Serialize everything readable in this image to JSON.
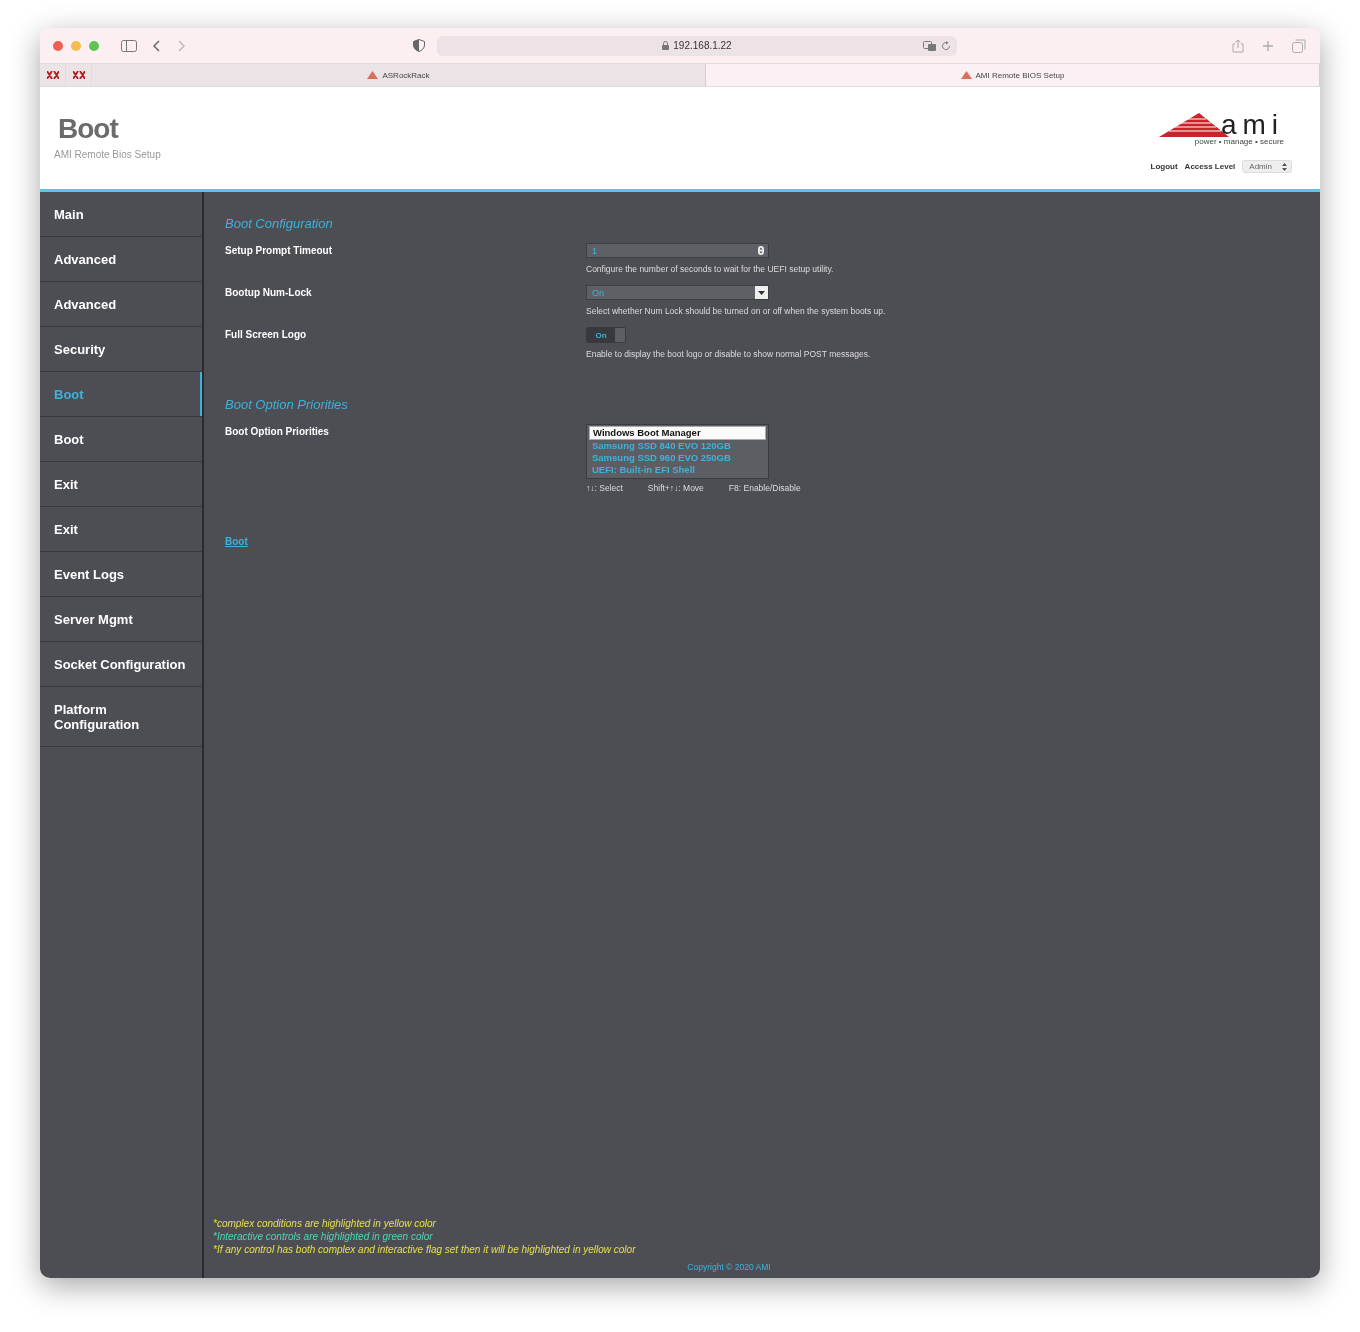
{
  "browser": {
    "url": "192.168.1.22",
    "tabs": [
      {
        "title": "ASRockRack",
        "selected": false
      },
      {
        "title": "AMI Remote BIOS Setup",
        "selected": true
      }
    ]
  },
  "header": {
    "title": "Boot",
    "subtitle": "AMI Remote Bios Setup",
    "logo": {
      "wordmark": "ami",
      "tagline": "power • manage • secure"
    },
    "logout": "Logout",
    "access_level_label": "Access Level",
    "access_level_value": "Admin"
  },
  "sidebar": {
    "items": [
      {
        "label": "Main",
        "selected": false
      },
      {
        "label": "Advanced",
        "selected": false
      },
      {
        "label": "Advanced",
        "selected": false
      },
      {
        "label": "Security",
        "selected": false
      },
      {
        "label": "Boot",
        "selected": true
      },
      {
        "label": "Boot",
        "selected": false
      },
      {
        "label": "Exit",
        "selected": false
      },
      {
        "label": "Exit",
        "selected": false
      },
      {
        "label": "Event Logs",
        "selected": false
      },
      {
        "label": "Server Mgmt",
        "selected": false
      },
      {
        "label": "Socket Configuration",
        "selected": false
      },
      {
        "label": "Platform Configuration",
        "selected": false
      }
    ]
  },
  "sections": [
    {
      "heading": "Boot Configuration",
      "settings": [
        {
          "kind": "number",
          "label": "Setup Prompt Timeout",
          "value": "1",
          "help": "Configure the number of seconds to wait for the UEFI setup utility."
        },
        {
          "kind": "select",
          "label": "Bootup Num-Lock",
          "value": "On",
          "help": "Select whether Num Lock should be turned on or off when the system boots up."
        },
        {
          "kind": "toggle",
          "label": "Full Screen Logo",
          "value": "On",
          "on": true,
          "help": "Enable to display the boot logo or disable to show normal POST messages."
        }
      ]
    },
    {
      "heading": "Boot Option Priorities",
      "settings": [
        {
          "kind": "list",
          "label": "Boot Option Priorities",
          "options": [
            {
              "label": "Windows Boot Manager",
              "selected": true
            },
            {
              "label": "Samsung SSD 840 EVO 120GB",
              "selected": false
            },
            {
              "label": "Samsung SSD 960 EVO 250GB",
              "selected": false
            },
            {
              "label": "UEFI: Built-in EFI Shell",
              "selected": false
            }
          ],
          "hints": [
            "↑↓: Select",
            "Shift+↑↓: Move",
            "F8: Enable/Disable"
          ]
        }
      ]
    }
  ],
  "breadcrumb_link": "Boot",
  "notes": [
    {
      "text": "*complex conditions are highlighted in yellow color",
      "color": "#e6e04a"
    },
    {
      "text": "*Interactive controls are highlighted in green color",
      "color": "#4fd6b4"
    },
    {
      "text": "*If any control has both complex and interactive flag set then it will be highlighted in yellow color",
      "color": "#e6e04a"
    }
  ],
  "copyright": "Copyright © 2020 AMI"
}
